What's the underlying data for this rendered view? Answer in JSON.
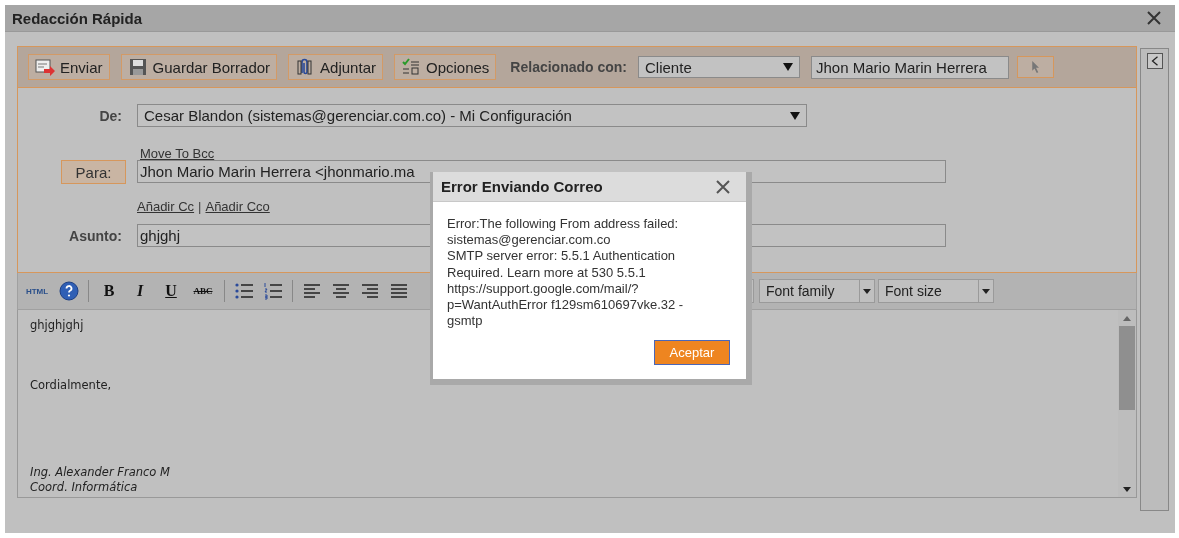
{
  "window": {
    "title": "Redacción Rápida"
  },
  "toolbar": {
    "buttons": [
      {
        "kind": "send",
        "label": "Enviar"
      },
      {
        "kind": "save",
        "label": "Guardar Borrador"
      },
      {
        "kind": "attach",
        "label": "Adjuntar"
      },
      {
        "kind": "options",
        "label": "Opciones"
      }
    ],
    "related_label": "Relacionado con:",
    "related_type": "Cliente",
    "related_name": "Jhon Mario Marin Herrera"
  },
  "form": {
    "from_label": "De:",
    "from_value": "Cesar Blandon (sistemas@gerenciar.com.co) - Mi Configuración",
    "move_bcc": "Move To Bcc",
    "to_button": "Para:",
    "to_value": "Jhon Mario Marin Herrera <jhonmario.ma",
    "add_cc": "Añadir Cc",
    "separator": "|",
    "add_cco": "Añadir Cco",
    "subject_label": "Asunto:",
    "subject_value": "ghjghj"
  },
  "editor": {
    "html_label": "HTML",
    "format_buttons": [
      {
        "kind": "bold",
        "label": "B"
      },
      {
        "kind": "italic",
        "label": "I"
      },
      {
        "kind": "underline",
        "label": "U"
      },
      {
        "kind": "strike",
        "label": "ABC"
      }
    ],
    "font_family": "Font family",
    "font_size": "Font size",
    "body": [
      {
        "kind": "text",
        "text": "ghjghjghj"
      },
      {
        "kind": "text",
        "text": "Cordialmente,"
      },
      {
        "kind": "signature",
        "text": "Ing. Alexander Franco M"
      },
      {
        "kind": "signature",
        "text": "Coord. Informática"
      }
    ]
  },
  "dialog": {
    "title": "Error Enviando Correo",
    "message": "Error:The following From address failed:\nsistemas@gerenciar.com.co\nSMTP server error: 5.5.1 Authentication\nRequired. Learn more at 530 5.5.1\nhttps://support.google.com/mail/?\np=WantAuthError f129sm610697vke.32 -\ngsmtp",
    "button": "Aceptar"
  }
}
